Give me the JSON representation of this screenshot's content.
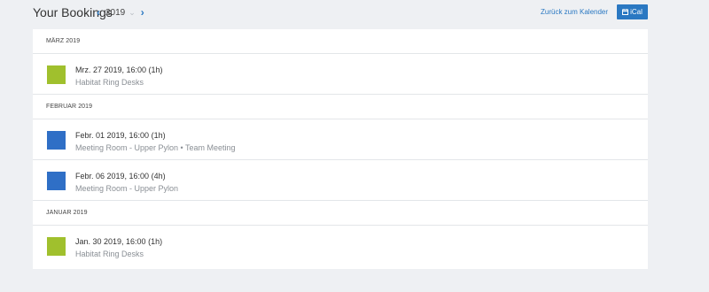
{
  "header": {
    "title": "Your Bookings",
    "year": "2019",
    "back_link": "Zurück zum Kalender",
    "ical_label": "iCal"
  },
  "colors": {
    "accent": "#2a78c2",
    "green": "#a0c02d",
    "blue": "#2f6fc6"
  },
  "months": [
    {
      "label": "MÄRZ 2019",
      "bookings": [
        {
          "time": "Mrz. 27 2019, 16:00 (1h)",
          "room": "Habitat Ring Desks",
          "color": "#a0c02d"
        }
      ]
    },
    {
      "label": "FEBRUAR 2019",
      "bookings": [
        {
          "time": "Febr. 01 2019, 16:00 (1h)",
          "room": "Meeting Room - Upper Pylon • Team Meeting",
          "color": "#2f6fc6"
        },
        {
          "time": "Febr. 06 2019, 16:00 (4h)",
          "room": "Meeting Room - Upper Pylon",
          "color": "#2f6fc6"
        }
      ]
    },
    {
      "label": "JANUAR 2019",
      "bookings": [
        {
          "time": "Jan. 30 2019, 16:00 (1h)",
          "room": "Habitat Ring Desks",
          "color": "#a0c02d"
        }
      ]
    }
  ]
}
